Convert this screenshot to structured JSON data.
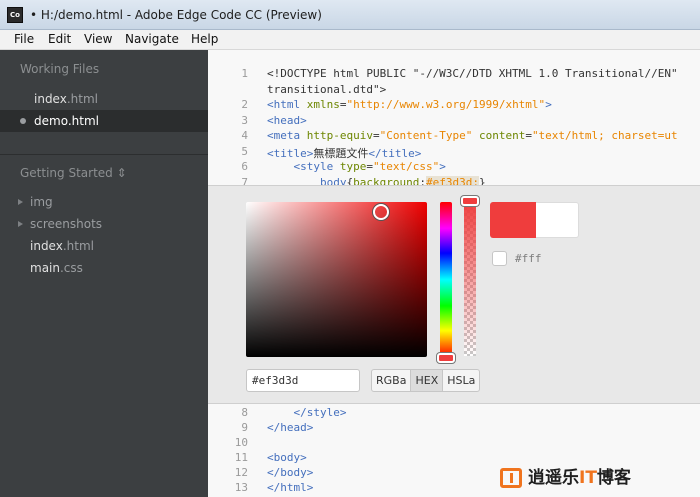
{
  "window": {
    "app_icon_text": "Co",
    "title": "• H:/demo.html - Adobe Edge Code CC (Preview)"
  },
  "menu": {
    "items": [
      "File",
      "Edit",
      "View",
      "Navigate",
      "Help"
    ]
  },
  "sidebar": {
    "working_files_heading": "Working Files",
    "working_files": [
      {
        "name": "index",
        "ext": ".html",
        "selected": false,
        "modified": false
      },
      {
        "name": "demo.html",
        "ext": "",
        "selected": true,
        "modified": true
      }
    ],
    "project_heading": "Getting Started ⇕",
    "project_tree": [
      {
        "name": "img",
        "ext": "",
        "type": "folder"
      },
      {
        "name": "screenshots",
        "ext": "",
        "type": "folder"
      },
      {
        "name": "index",
        "ext": ".html",
        "type": "file"
      },
      {
        "name": "main",
        "ext": ".css",
        "type": "file"
      }
    ]
  },
  "editor": {
    "top_lines": [
      {
        "num": "1",
        "html": "<span class=\"txt\">&lt;!DOCTYPE html PUBLIC \"-//W3C//DTD XHTML 1.0 Transitional//EN\"</span>"
      },
      {
        "num": "",
        "html": "<span class=\"txt\">transitional.dtd\"&gt;</span>"
      },
      {
        "num": "2",
        "html": "<span class=\"tag\">&lt;html</span> <span class=\"attr\">xmlns</span>=<span class=\"str\">\"http://www.w3.org/1999/xhtml\"</span><span class=\"tag\">&gt;</span>"
      },
      {
        "num": "3",
        "html": "<span class=\"tag\">&lt;head&gt;</span>"
      },
      {
        "num": "4",
        "html": "<span class=\"tag\">&lt;meta</span> <span class=\"attr\">http-equiv</span>=<span class=\"str\">\"Content-Type\"</span> <span class=\"attr\">content</span>=<span class=\"str\">\"text/html; charset=ut</span>"
      },
      {
        "num": "5",
        "html": "<span class=\"tag\">&lt;title&gt;</span><span class=\"txt\">無標題文件</span><span class=\"tag\">&lt;/title&gt;</span>"
      },
      {
        "num": "6",
        "html": "    <span class=\"tag\">&lt;style</span> <span class=\"attr\">type</span>=<span class=\"str\">\"text/css\"</span><span class=\"tag\">&gt;</span>"
      },
      {
        "num": "7",
        "html": "        <span class=\"tag\">body</span>{<span class=\"css-prop\">background</span>:<span class=\"css-val-hl\">#ef3d3d;</span>}"
      }
    ],
    "bottom_lines": [
      {
        "num": "8",
        "html": "    <span class=\"tag\">&lt;/style&gt;</span>"
      },
      {
        "num": "9",
        "html": "<span class=\"tag\">&lt;/head&gt;</span>"
      },
      {
        "num": "10",
        "html": ""
      },
      {
        "num": "11",
        "html": "<span class=\"tag\">&lt;body&gt;</span>"
      },
      {
        "num": "12",
        "html": "<span class=\"tag\">&lt;/body&gt;</span>"
      },
      {
        "num": "13",
        "html": "<span class=\"tag\">&lt;/html&gt;</span>"
      }
    ]
  },
  "color_editor": {
    "current_color": "#ef3d3d",
    "original_color": "#ffffff",
    "hex_value": "#ef3d3d",
    "used_color_label": "#fff",
    "modes": [
      {
        "label": "RGBa",
        "active": false
      },
      {
        "label": "HEX",
        "active": true
      },
      {
        "label": "HSLa",
        "active": false
      }
    ]
  },
  "watermark": {
    "text_part1": "逍遥乐",
    "text_highlight": "IT",
    "text_part2": "博客"
  },
  "colors": {
    "sidebar_bg": "#3c3f41",
    "editor_bg": "#f8f8f8",
    "tag": "#446fbd",
    "attr": "#6d8600",
    "string": "#e88501",
    "accent": "#ef3d3d"
  }
}
